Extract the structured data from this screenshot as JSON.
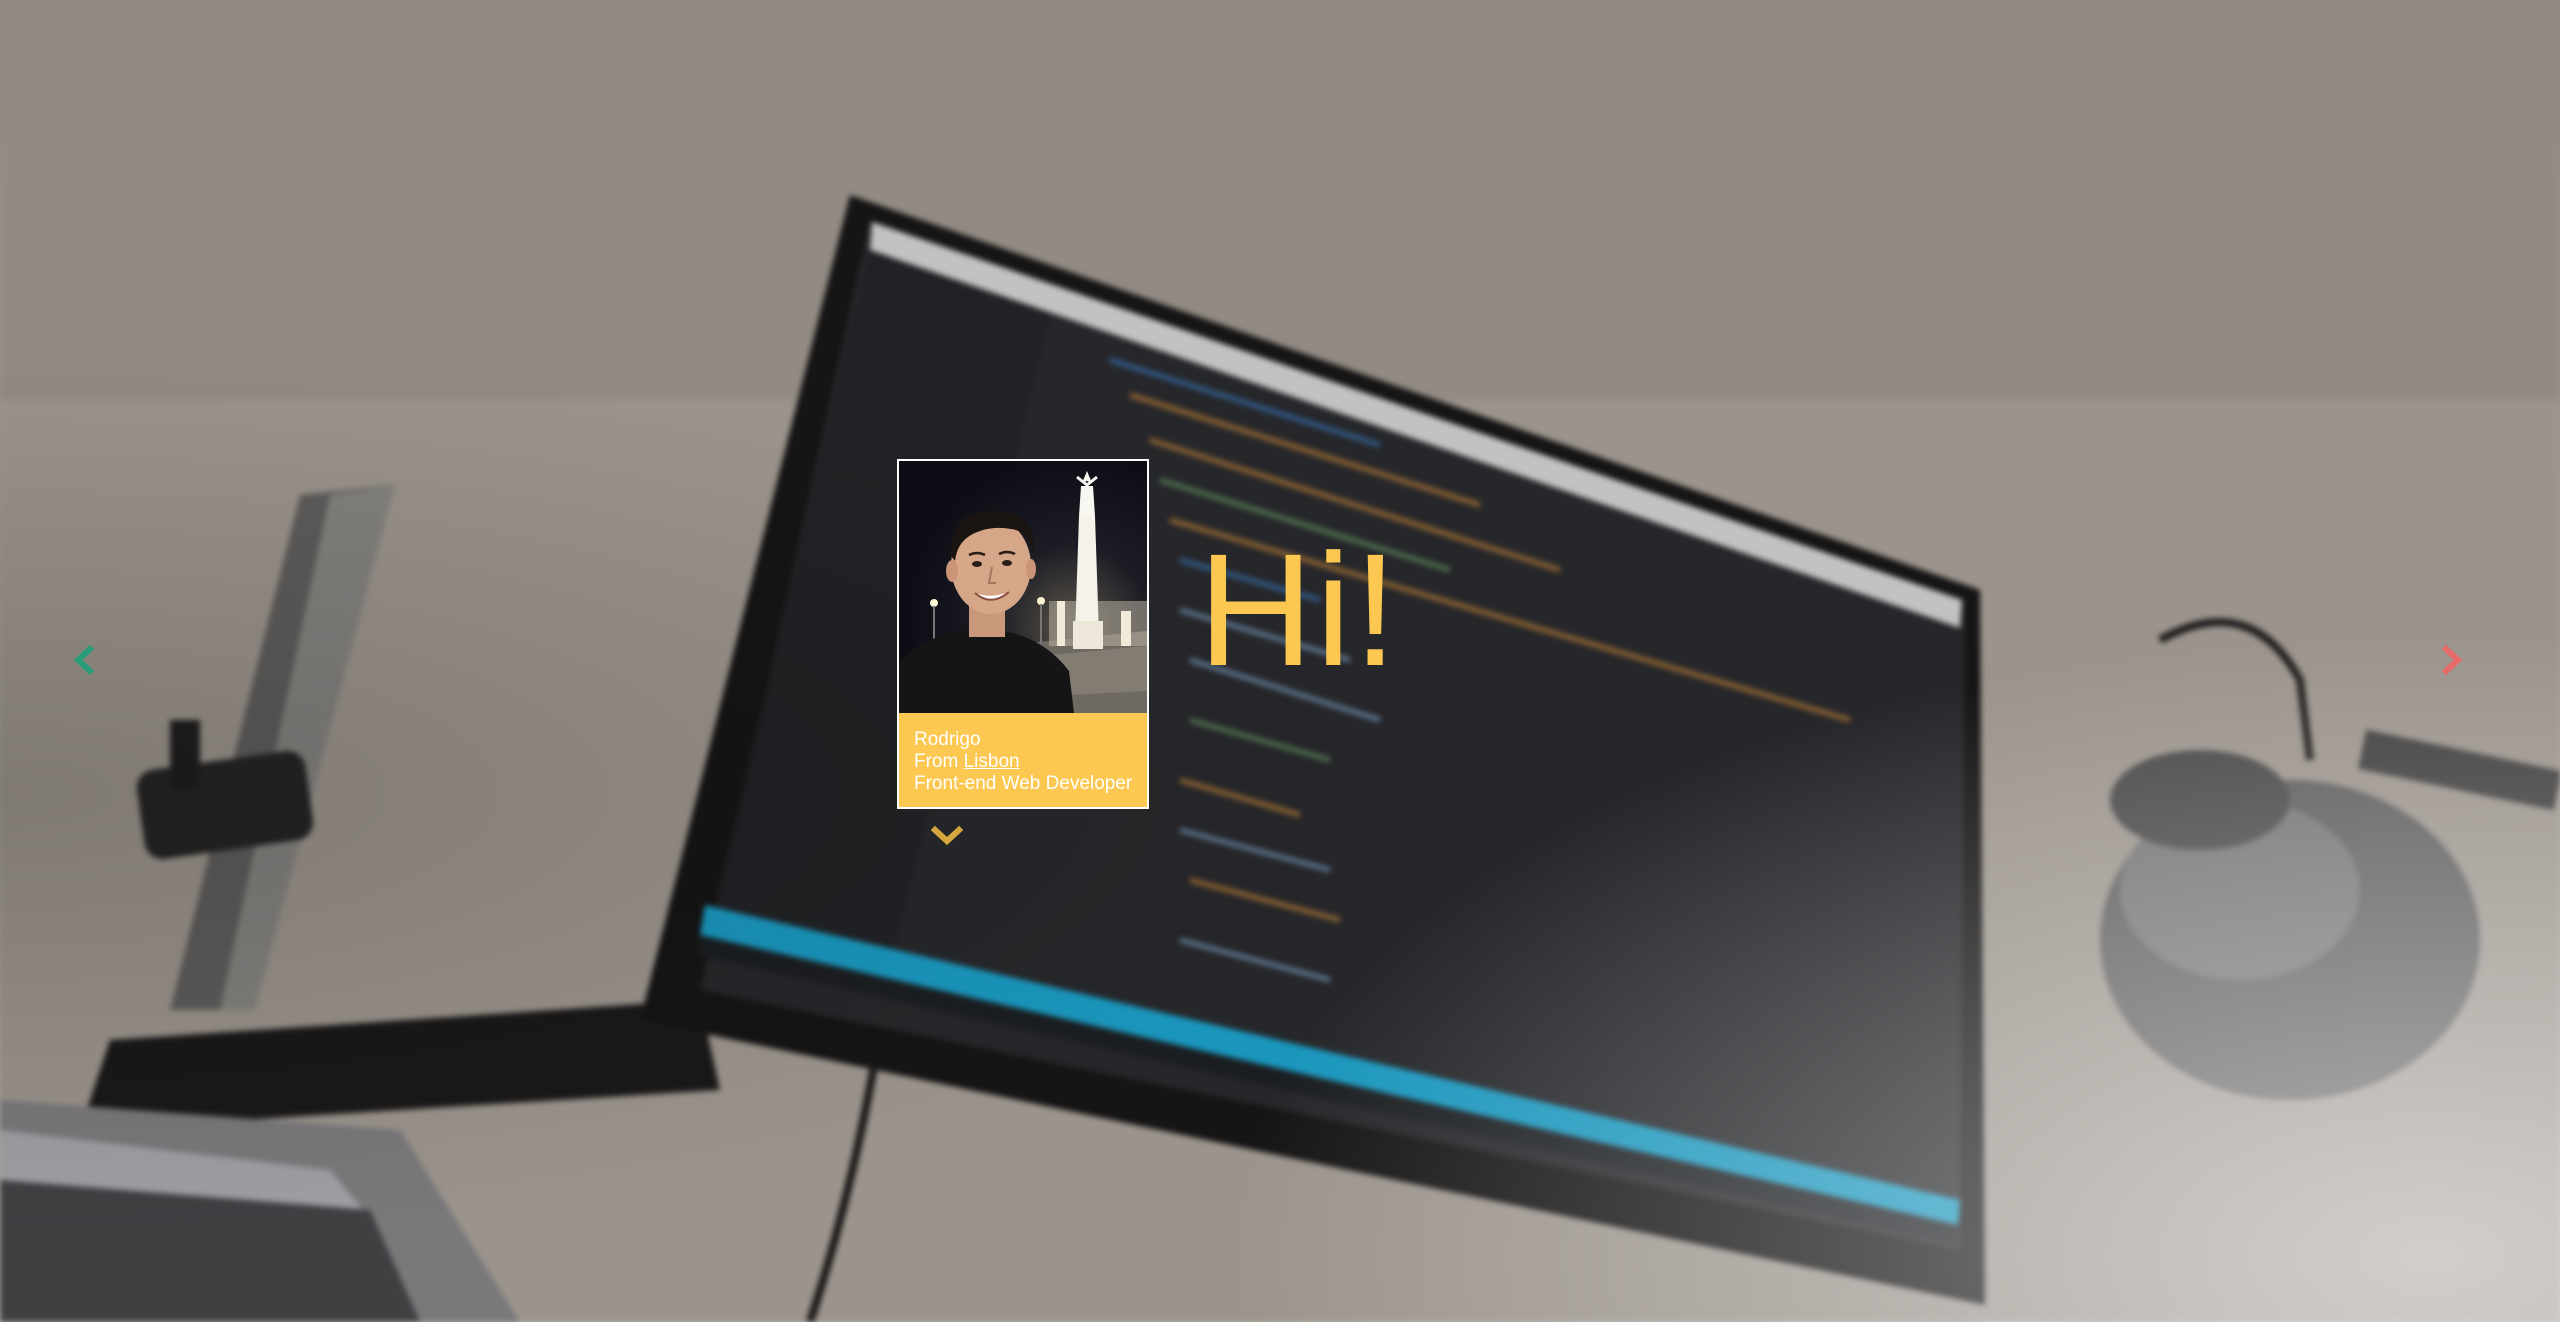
{
  "greeting": "Hi!",
  "profile": {
    "name": "Rodrigo",
    "from_prefix": "From ",
    "city": "Lisbon",
    "role": "Front-end Web Developer",
    "photo_icon": "profile-photo"
  },
  "navigation": {
    "prev_icon": "chevron-left-icon",
    "next_icon": "chevron-right-icon",
    "scroll_icon": "chevron-down-icon"
  },
  "colors": {
    "accent": "#fcc851",
    "prev_arrow": "#2a9d78",
    "next_arrow": "#e86a6a",
    "card_border": "#ffffff"
  }
}
